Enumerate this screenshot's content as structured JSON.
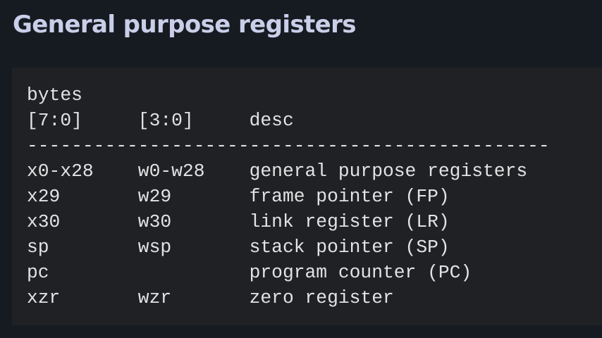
{
  "heading": "General purpose registers",
  "code": {
    "lines": [
      "bytes",
      "[7:0]     [3:0]     desc",
      "-----------------------------------------------",
      "x0-x28    w0-w28    general purpose registers",
      "x29       w29       frame pointer (FP)",
      "x30       w30       link register (LR)",
      "sp        wsp       stack pointer (SP)",
      "pc                  program counter (PC)",
      "xzr       wzr       zero register"
    ]
  }
}
